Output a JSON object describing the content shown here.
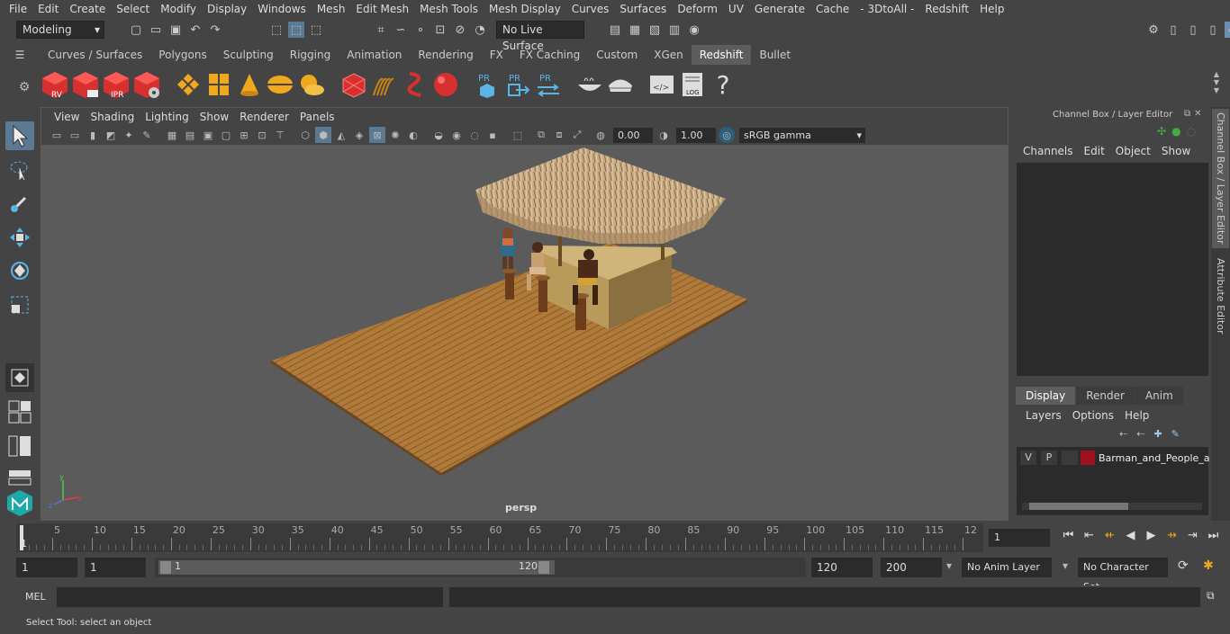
{
  "menubar": [
    "File",
    "Edit",
    "Create",
    "Select",
    "Modify",
    "Display",
    "Windows",
    "Mesh",
    "Edit Mesh",
    "Mesh Tools",
    "Mesh Display",
    "Curves",
    "Surfaces",
    "Deform",
    "UV",
    "Generate",
    "Cache",
    "- 3DtoAll -",
    "Redshift",
    "Help"
  ],
  "status": {
    "mode": "Modeling",
    "live_surface": "No Live Surface"
  },
  "shelf_tabs": [
    "Curves / Surfaces",
    "Polygons",
    "Sculpting",
    "Rigging",
    "Animation",
    "Rendering",
    "FX",
    "FX Caching",
    "Custom",
    "XGen",
    "Redshift",
    "Bullet"
  ],
  "shelf_active": "Redshift",
  "shelf_labels": {
    "rv": "RV",
    "ipr": "IPR",
    "pr1": "PR",
    "pr2": "PR",
    "pr3": "PR",
    "log": "LOG",
    "help": "?"
  },
  "viewport": {
    "menus": [
      "View",
      "Shading",
      "Lighting",
      "Show",
      "Renderer",
      "Panels"
    ],
    "exposure": "0.00",
    "gamma": "1.00",
    "colorspace": "sRGB gamma",
    "camera": "persp"
  },
  "channel_box": {
    "title": "Channel Box / Layer Editor",
    "menus": [
      "Channels",
      "Edit",
      "Object",
      "Show"
    ]
  },
  "layer_editor": {
    "tabs": [
      "Display",
      "Render",
      "Anim"
    ],
    "active_tab": "Display",
    "menus": [
      "Layers",
      "Options",
      "Help"
    ],
    "layer": {
      "v": "V",
      "p": "P",
      "name": "Barman_and_People_a",
      "color": "#a01020"
    }
  },
  "side_tabs": [
    "Channel Box / Layer Editor",
    "Attribute Editor"
  ],
  "timeline": {
    "ticks": [
      "5",
      "10",
      "15",
      "20",
      "25",
      "30",
      "35",
      "40",
      "45",
      "50",
      "55",
      "60",
      "65",
      "70",
      "75",
      "80",
      "85",
      "90",
      "95",
      "100",
      "105",
      "110",
      "115",
      "12"
    ],
    "current_frame": "1",
    "start_marker": "1"
  },
  "range": {
    "start": "1",
    "playback_start": "1",
    "slider_start": "1",
    "slider_end": "120",
    "playback_end": "120",
    "end": "200",
    "anim_layer": "No Anim Layer",
    "character_set": "No Character Set"
  },
  "cmdline": {
    "lang": "MEL"
  },
  "help_text": "Select Tool: select an object",
  "colors": {
    "accent": "#5ab4e6",
    "redshift_red": "#d8302f",
    "wood": "#b07a3a",
    "thatch": "#c8ab84"
  }
}
